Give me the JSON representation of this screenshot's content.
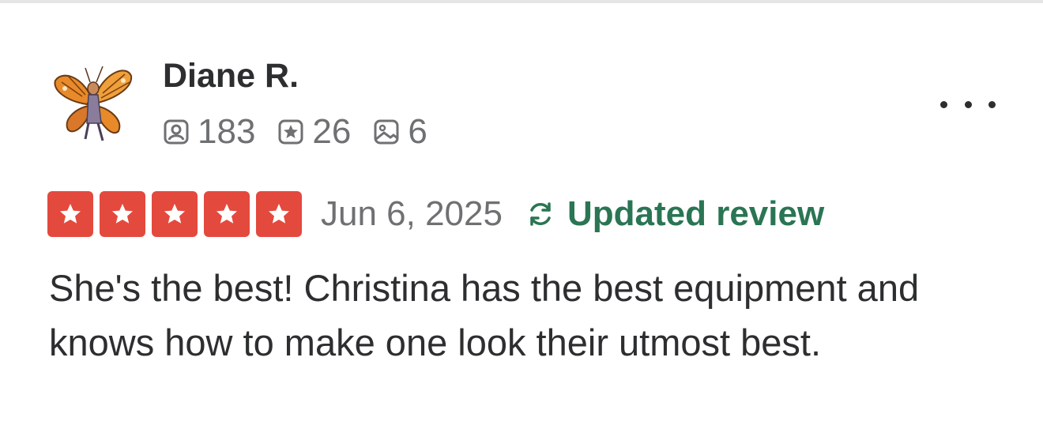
{
  "review": {
    "user": {
      "name": "Diane R.",
      "avatar_icon": "butterfly-fairy-avatar"
    },
    "stats": {
      "friends": "183",
      "friends_icon": "friends-icon",
      "reviews": "26",
      "reviews_icon": "review-star-icon",
      "photos": "6",
      "photos_icon": "photo-icon"
    },
    "rating": {
      "stars": 5,
      "max": 5,
      "color": "#e4493e"
    },
    "date": "Jun 6, 2025",
    "updated": {
      "label": "Updated review",
      "icon": "refresh-icon",
      "color": "#2a7553"
    },
    "more_icon": "more-options-icon",
    "text": "She's the best! Christina has the best equipment and knows how to make one look their utmost best."
  }
}
